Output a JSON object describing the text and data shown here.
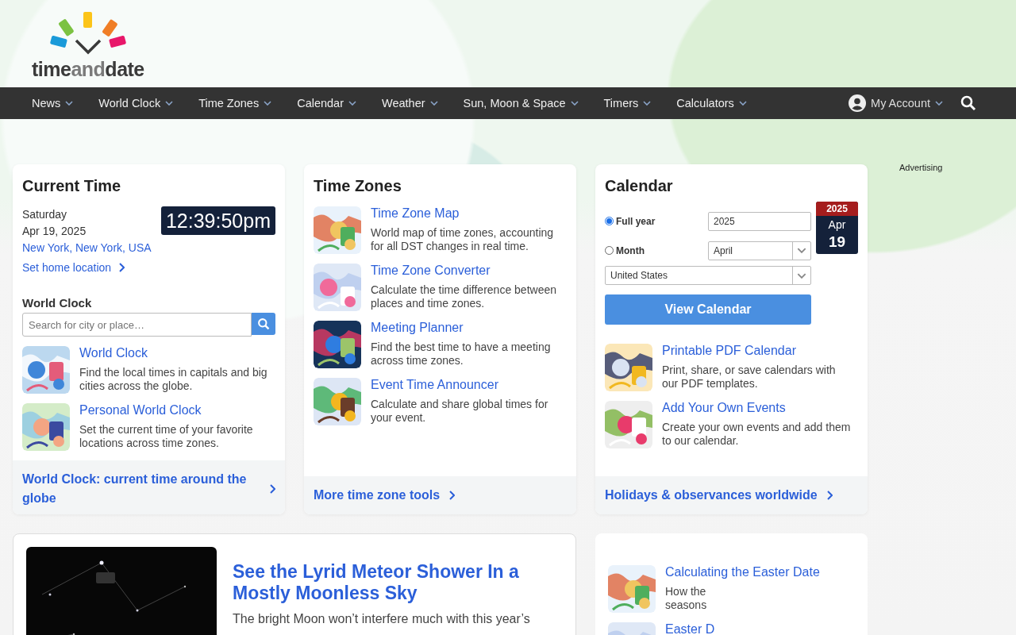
{
  "logo": {
    "parts": [
      "time",
      "and",
      "date"
    ]
  },
  "nav": {
    "items": [
      "News",
      "World Clock",
      "Time Zones",
      "Calendar",
      "Weather",
      "Sun, Moon & Space",
      "Timers",
      "Calculators"
    ],
    "account": "My Account"
  },
  "advertising": "Advertising",
  "current_time": {
    "title": "Current Time",
    "day": "Saturday",
    "date": "Apr 19, 2025",
    "location": "New York, New York, USA",
    "home_link": "Set home location",
    "clock": "12:39:50pm",
    "world_clock_heading": "World Clock",
    "search": {
      "placeholder": "Search for city or place…"
    },
    "items": [
      {
        "title": "World Clock",
        "text": "Find the local times in capitals and big cities across the globe."
      },
      {
        "title": "Personal World Clock",
        "text": "Set the current time of your favorite locations across time zones."
      }
    ],
    "footer": "World Clock: current time around the globe"
  },
  "time_zones": {
    "title": "Time Zones",
    "items": [
      {
        "title": "Time Zone Map",
        "text": "World map of time zones, accounting for all DST changes in real time."
      },
      {
        "title": "Time Zone Converter",
        "text": "Calculate the time difference between places and time zones."
      },
      {
        "title": "Meeting Planner",
        "text": "Find the best time to have a meeting across time zones."
      },
      {
        "title": "Event Time Announcer",
        "text": "Calculate and share global times for your event."
      }
    ],
    "footer": "More time zone tools"
  },
  "calendar": {
    "title": "Calendar",
    "options": [
      {
        "label": "Full year",
        "selected": true
      },
      {
        "label": "Month",
        "selected": false
      }
    ],
    "year": "2025",
    "month": "April",
    "country": "United States",
    "button": "View Calendar",
    "badge": {
      "year": "2025",
      "month": "Apr",
      "day": "19"
    },
    "items": [
      {
        "title": "Printable PDF Calendar",
        "text": "Print, share, or save calendars with our PDF templates."
      },
      {
        "title": "Add Your Own Events",
        "text": "Create your own events and add them to our calendar."
      }
    ],
    "footer": "Holidays & observances worldwide"
  },
  "article": {
    "title": "See the Lyrid Meteor Shower In a Mostly Moonless Sky",
    "text": "The bright Moon won’t interfere much with this year’s"
  },
  "side_list": {
    "items": [
      {
        "title": "Calculating the Easter Date",
        "lines": [
          "How the",
          "seasons"
        ]
      },
      {
        "title": "Easter D"
      }
    ]
  }
}
